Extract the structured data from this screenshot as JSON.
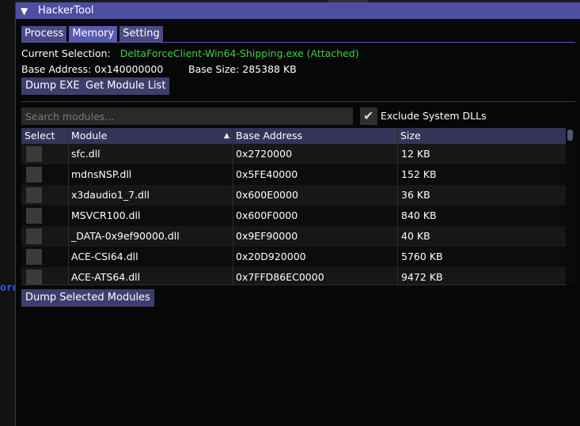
{
  "background": {
    "left_fragment": "ore"
  },
  "window": {
    "title": "HackerTool",
    "collapse_glyph": "▼"
  },
  "tabs": [
    {
      "label": "Process"
    },
    {
      "label": "Memory"
    },
    {
      "label": "Setting"
    }
  ],
  "info": {
    "current_selection_label": "Current Selection:",
    "current_selection_value": "DeltaForceClient-Win64-Shipping.exe (Attached)",
    "base_address": "Base Address: 0x140000000",
    "base_size": "Base Size: 285388 KB"
  },
  "buttons": {
    "dump_exe": "Dump EXE",
    "get_module_list": "Get Module List",
    "dump_selected": "Dump Selected Modules"
  },
  "search": {
    "placeholder": "Search modules..."
  },
  "exclude": {
    "label": "Exclude System DLLs",
    "checked": true
  },
  "table": {
    "columns": [
      "Select",
      "Module",
      "Base Address",
      "Size"
    ],
    "sort_glyph": "▲",
    "rows": [
      {
        "module": "sfc.dll",
        "base": "0x2720000",
        "size": "12 KB"
      },
      {
        "module": "mdnsNSP.dll",
        "base": "0x5FE40000",
        "size": "152 KB"
      },
      {
        "module": "x3daudio1_7.dll",
        "base": "0x600E0000",
        "size": "36 KB"
      },
      {
        "module": "MSVCR100.dll",
        "base": "0x600F0000",
        "size": "840 KB"
      },
      {
        "module": "_DATA-0x9ef90000.dll",
        "base": "0x9EF90000",
        "size": "40 KB"
      },
      {
        "module": "ACE-CSI64.dll",
        "base": "0x20D920000",
        "size": "5760 KB"
      },
      {
        "module": "ACE-ATS64.dll",
        "base": "0x7FFD86EC0000",
        "size": "9472 KB"
      }
    ]
  },
  "colors": {
    "accent": "#4e4ea0",
    "attached_text": "#3fd13f",
    "button": "#3e3e6e"
  }
}
